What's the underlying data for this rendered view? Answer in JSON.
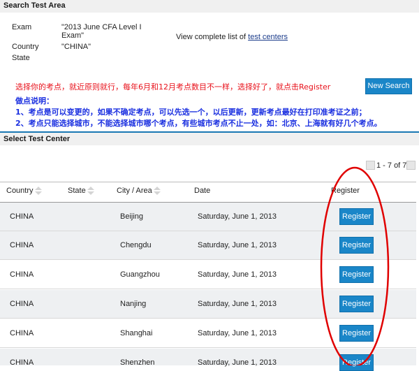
{
  "search": {
    "title": "Search Test Area",
    "exam_label": "Exam",
    "exam_value": "\"2013 June CFA Level I Exam\"",
    "country_label": "Country",
    "country_value": "\"CHINA\"",
    "state_label": "State",
    "view_list_text": "View complete list of",
    "test_centers_link": "test centers",
    "new_search_label": "New Search"
  },
  "annotations": {
    "line1": "选择你的考点，就近原则就行，每年6月和12月考点数目不一样，选择好了，就点击Register",
    "line2": "做点说明：",
    "line3": "1、考点是可以变更的，如果不确定考点，可以先选一个，以后更新，更新考点最好在打印准考证之前；",
    "line4": "2、考点只能选择城市，不能选择城市哪个考点，有些城市考点不止一处，如：北京、上海就有好几个考点。"
  },
  "select": {
    "title": "Select Test Center",
    "pager_text": "1 - 7 of 7",
    "columns": {
      "country": "Country",
      "state": "State",
      "city": "City / Area",
      "date": "Date",
      "register": "Register"
    },
    "rows": [
      {
        "country": "CHINA",
        "state": "",
        "city": "Beijing",
        "date": "Saturday, June 1, 2013",
        "action": "Register"
      },
      {
        "country": "CHINA",
        "state": "",
        "city": "Chengdu",
        "date": "Saturday, June 1, 2013",
        "action": "Register"
      },
      {
        "country": "CHINA",
        "state": "",
        "city": "Guangzhou",
        "date": "Saturday, June 1, 2013",
        "action": "Register"
      },
      {
        "country": "CHINA",
        "state": "",
        "city": "Nanjing",
        "date": "Saturday, June 1, 2013",
        "action": "Register"
      },
      {
        "country": "CHINA",
        "state": "",
        "city": "Shanghai",
        "date": "Saturday, June 1, 2013",
        "action": "Register"
      },
      {
        "country": "CHINA",
        "state": "",
        "city": "Shenzhen",
        "date": "Saturday, June 1, 2013",
        "action": "Register"
      }
    ]
  },
  "colors": {
    "accent": "#1a86c8",
    "annotation_red": "#e8101a",
    "annotation_blue": "#1a2fe0",
    "highlight_ellipse": "#e00000"
  }
}
